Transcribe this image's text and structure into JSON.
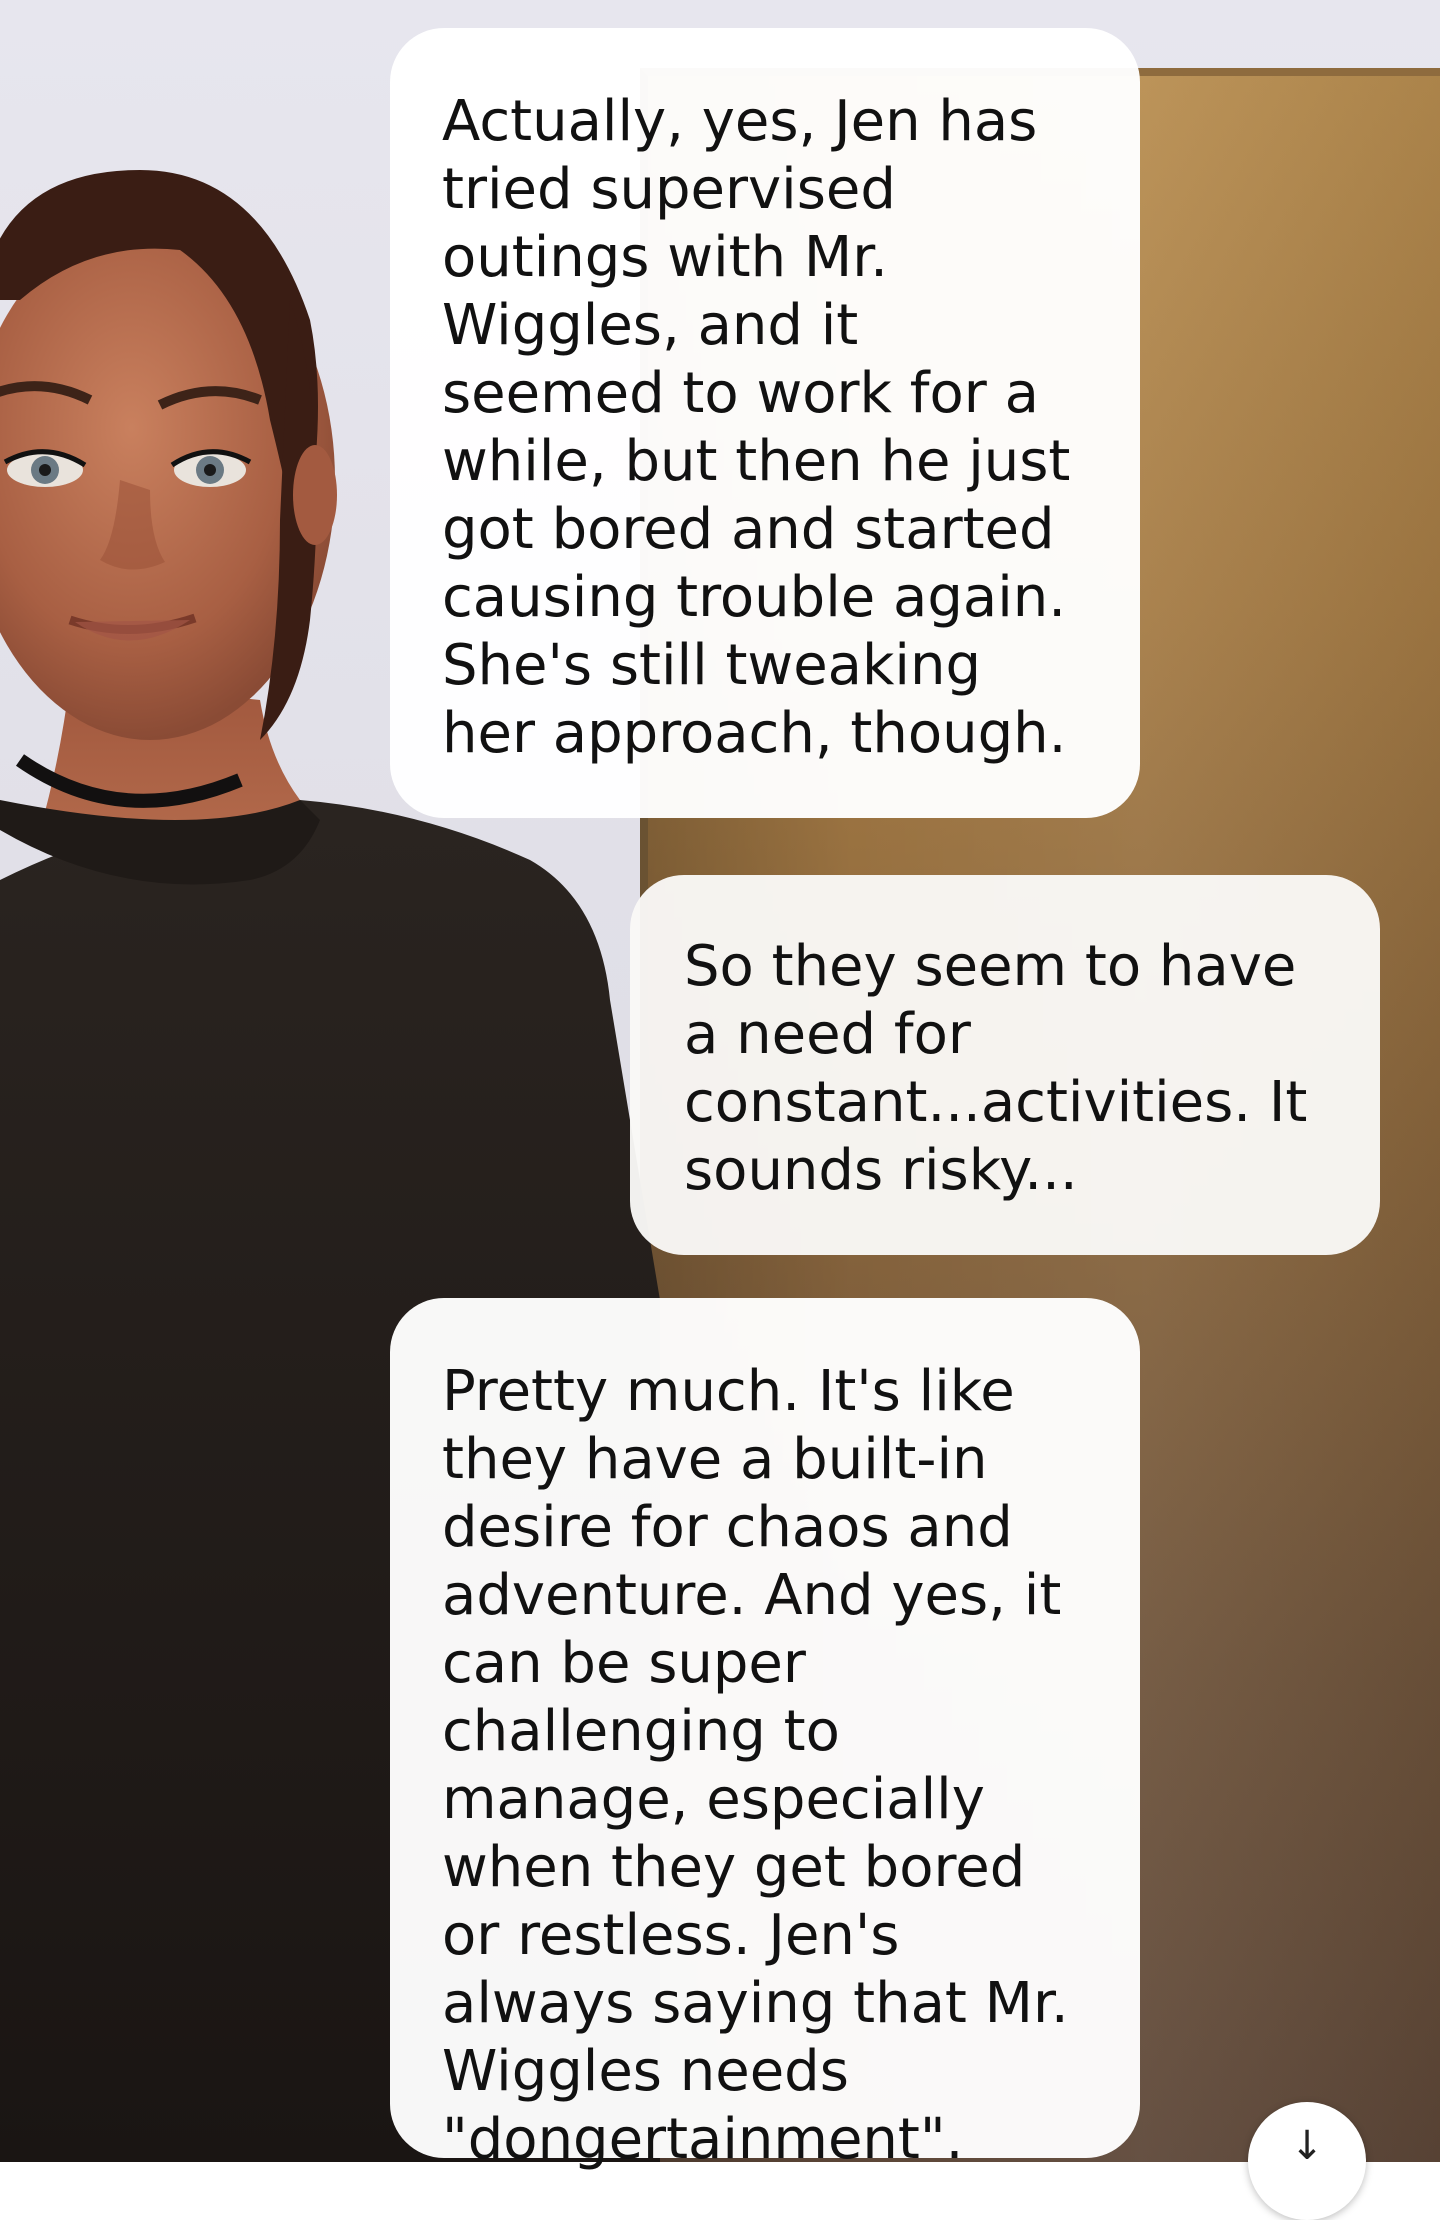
{
  "conversation": {
    "messages": [
      {
        "role": "ai",
        "text": "Actually, yes, Jen has tried supervised outings with Mr. Wiggles, and it seemed to work for a while, but then he just got bored and started causing trouble again. She's still tweaking her approach, though."
      },
      {
        "role": "user",
        "text": "So they seem to have a need for constant...activities.  It sounds risky..."
      },
      {
        "role": "ai",
        "text": "Pretty much. It's like they have a built-in desire for chaos and adventure. And yes, it can be super challenging to manage, especially when they get bored or restless. Jen's always saying that Mr. Wiggles needs \"dongertainment\"."
      }
    ]
  },
  "scroll_button": {
    "icon": "arrow-down-icon"
  },
  "colors": {
    "ai_bubble": "#ffffff",
    "user_bubble": "#faf9f7",
    "text": "#111111",
    "wall": "#e3e2ea",
    "door": "#a57b44",
    "shirt": "#1f1a17"
  }
}
